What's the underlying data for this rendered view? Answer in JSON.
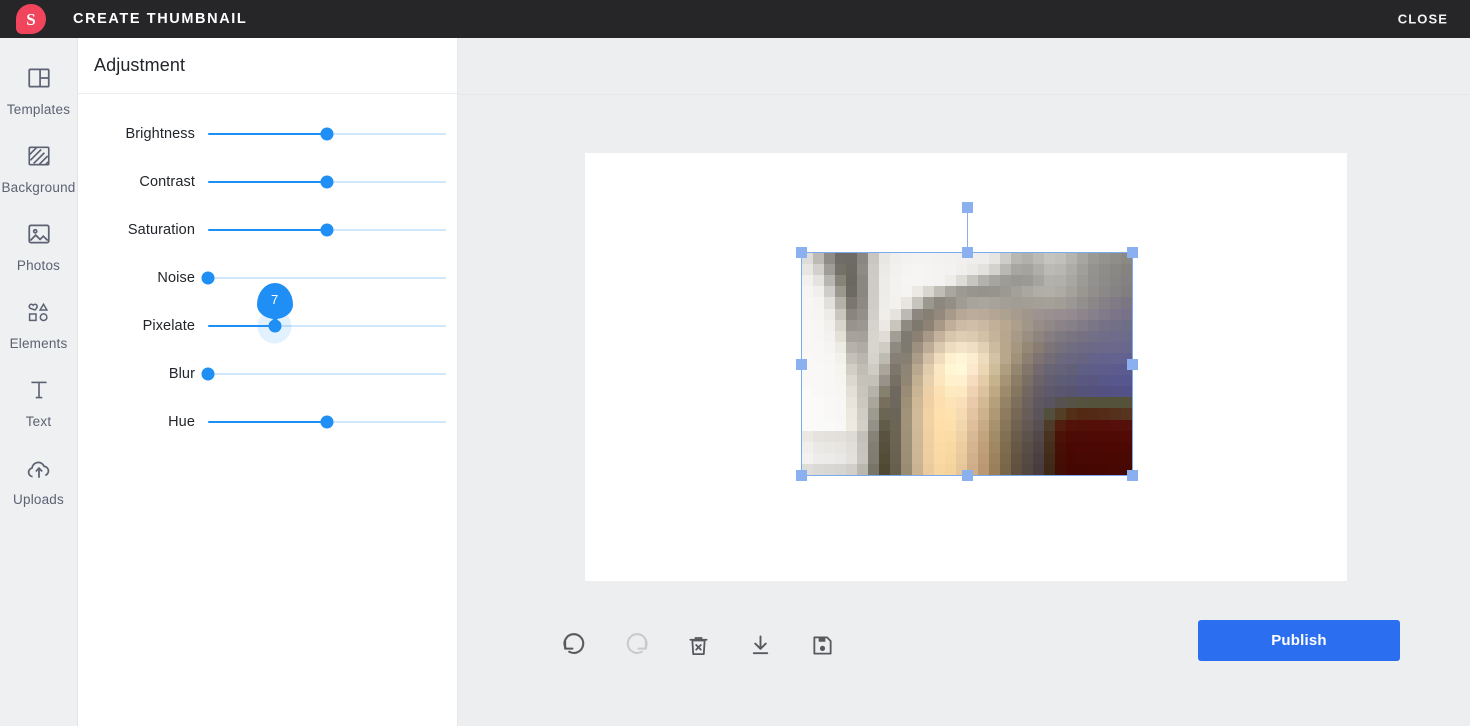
{
  "topbar": {
    "logo_icon": "speech-bubble-s-logo",
    "logo_letter": "S",
    "logo_color": "#f0455c",
    "title": "CREATE THUMBNAIL",
    "close_label": "CLOSE"
  },
  "sidebar": {
    "items": [
      {
        "label": "Templates",
        "icon": "templates-icon"
      },
      {
        "label": "Background",
        "icon": "background-icon"
      },
      {
        "label": "Photos",
        "icon": "photos-icon"
      },
      {
        "label": "Elements",
        "icon": "elements-icon"
      },
      {
        "label": "Text",
        "icon": "text-icon"
      },
      {
        "label": "Uploads",
        "icon": "uploads-icon"
      }
    ]
  },
  "panel": {
    "title": "Adjustment",
    "accent_color": "#1f8ff5",
    "track_color": "#cfe6fb",
    "sliders": [
      {
        "label": "Brightness",
        "percent": 50,
        "tooltip": null
      },
      {
        "label": "Contrast",
        "percent": 50,
        "tooltip": null
      },
      {
        "label": "Saturation",
        "percent": 50,
        "tooltip": null
      },
      {
        "label": "Noise",
        "percent": 0,
        "tooltip": null
      },
      {
        "label": "Pixelate",
        "percent": 28,
        "tooltip": "7"
      },
      {
        "label": "Blur",
        "percent": 0,
        "tooltip": null
      },
      {
        "label": "Hue",
        "percent": 50,
        "tooltip": null
      }
    ]
  },
  "workspace": {
    "canvas_background": "#ffffff",
    "selection_color": "#8ab0f0",
    "selected_object": "pixelated-kitchen-photo"
  },
  "toolbar": {
    "buttons": [
      {
        "name": "undo-button",
        "icon": "undo-icon",
        "enabled": true
      },
      {
        "name": "redo-button",
        "icon": "redo-icon",
        "enabled": false
      },
      {
        "name": "delete-button",
        "icon": "trash-x-icon",
        "enabled": true
      },
      {
        "name": "download-button",
        "icon": "download-icon",
        "enabled": true
      },
      {
        "name": "save-button",
        "icon": "floppy-disk-icon",
        "enabled": true
      }
    ],
    "publish_label": "Publish",
    "publish_color": "#2b6ff0"
  }
}
